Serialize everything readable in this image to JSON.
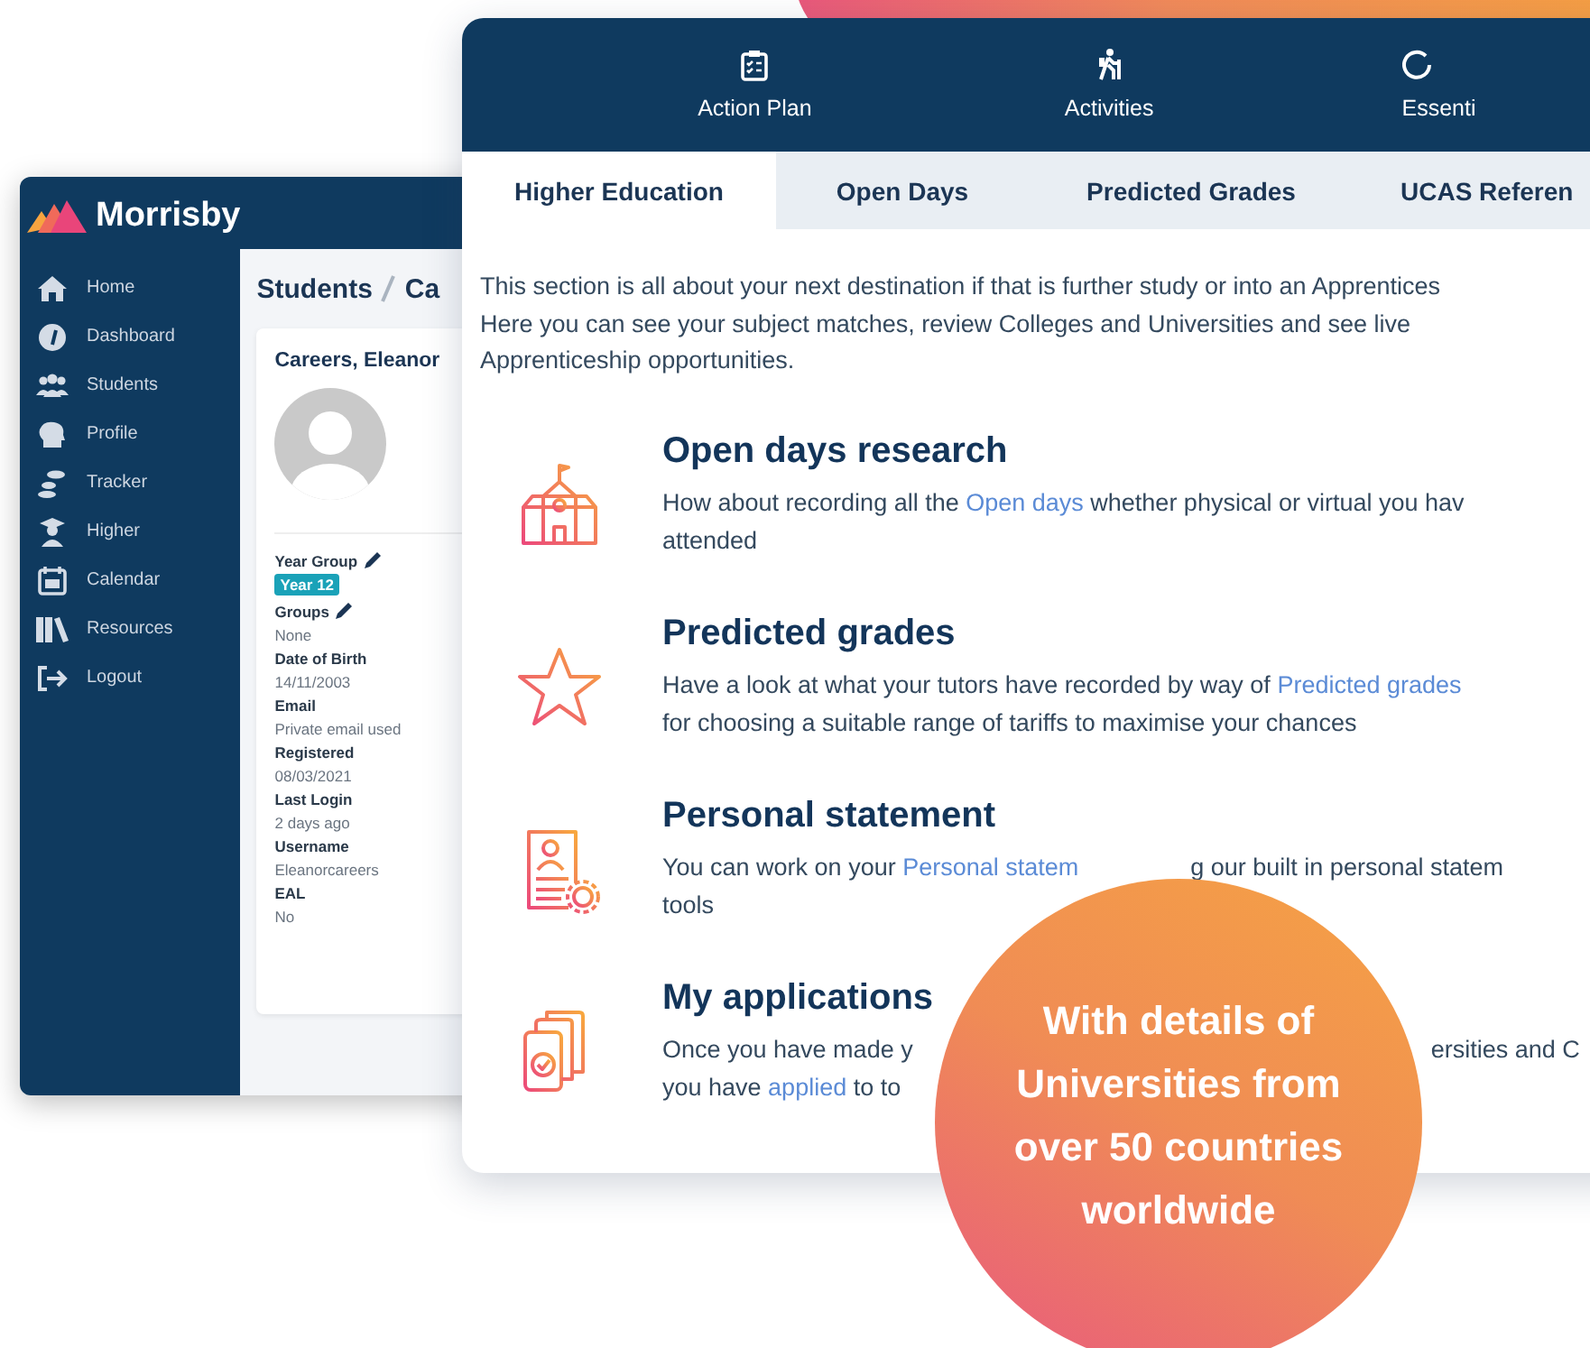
{
  "back_window": {
    "logo": "Morrisby",
    "sidebar": {
      "items": [
        {
          "label": "Home"
        },
        {
          "label": "Dashboard"
        },
        {
          "label": "Students"
        },
        {
          "label": "Profile"
        },
        {
          "label": "Tracker"
        },
        {
          "label": "Higher"
        },
        {
          "label": "Calendar"
        },
        {
          "label": "Resources"
        },
        {
          "label": "Logout"
        }
      ]
    },
    "breadcrumb": [
      "Students",
      "Ca"
    ],
    "student_card": {
      "name": "Careers, Eleanor",
      "fields": [
        {
          "label": "Year Group",
          "editable": true,
          "kind": "badge",
          "value": "Year 12"
        },
        {
          "label": "Groups",
          "editable": true,
          "kind": "text",
          "value": "None"
        },
        {
          "label": "Date of Birth",
          "editable": false,
          "kind": "text",
          "value": "14/11/2003"
        },
        {
          "label": "Email",
          "editable": false,
          "kind": "text",
          "value": "Private email used"
        },
        {
          "label": "Registered",
          "editable": false,
          "kind": "text",
          "value": "08/03/2021"
        },
        {
          "label": "Last Login",
          "editable": false,
          "kind": "text",
          "value": "2 days ago"
        },
        {
          "label": "Username",
          "editable": false,
          "kind": "text",
          "value": "Eleanorcareers"
        },
        {
          "label": "EAL",
          "editable": false,
          "kind": "text",
          "value": "No"
        }
      ]
    }
  },
  "front_window": {
    "nav": [
      {
        "label": "Action Plan"
      },
      {
        "label": "Activities"
      },
      {
        "label": "Essenti"
      }
    ],
    "tabs": [
      {
        "label": "Higher Education",
        "selected": true
      },
      {
        "label": "Open Days",
        "selected": false
      },
      {
        "label": "Predicted Grades",
        "selected": false
      },
      {
        "label": "UCAS Referen",
        "selected": false
      }
    ],
    "intro": [
      "This section is all about your next destination if that is further study or into an Apprentices",
      "Here you can see your subject matches, review Colleges and Universities and see live",
      "Apprenticeship opportunities."
    ],
    "sections": [
      {
        "title": "Open days research",
        "lines": [
          [
            [
              {
                "text": "How about recording all the "
              },
              {
                "text": "Open days",
                "link": true
              },
              {
                "text": " whether physical or virtual you hav"
              }
            ]
          ],
          [
            [
              {
                "text": "attended"
              }
            ]
          ]
        ]
      },
      {
        "title": "Predicted grades",
        "lines": [
          [
            [
              {
                "text": "Have a look at what your tutors have recorded by way of "
              },
              {
                "text": "Predicted grades",
                "link": true
              }
            ]
          ],
          [
            [
              {
                "text": "for choosing a suitable range of tariffs to maximise your chances"
              }
            ]
          ]
        ]
      },
      {
        "title": "Personal statement",
        "lines": [
          [
            [
              {
                "text": "You can work on your "
              },
              {
                "text": "Personal statem",
                "link": true
              }
            ],
            [
              {
                "text": "g our built in personal statem"
              }
            ]
          ],
          [
            [
              {
                "text": "tools"
              }
            ]
          ]
        ]
      },
      {
        "title": "My applications",
        "lines": [
          [
            [
              {
                "text": "Once you have made y"
              }
            ],
            [
              {
                "text": "ersities and C"
              }
            ]
          ],
          [
            [
              {
                "text": "you have "
              },
              {
                "text": "applied",
                "link": true
              },
              {
                "text": " to to"
              }
            ]
          ]
        ]
      }
    ]
  },
  "promo": [
    "With details of",
    "Universities from",
    "over 50 countries",
    "worldwide"
  ]
}
